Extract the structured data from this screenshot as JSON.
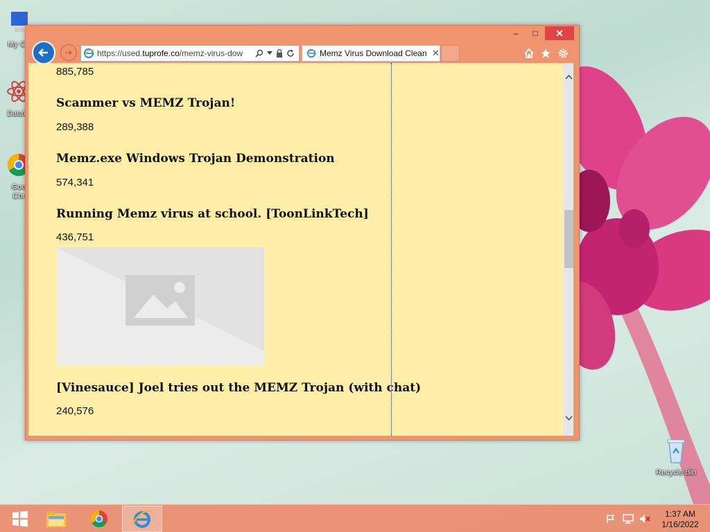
{
  "desktop": {
    "icons": [
      {
        "label": "My Co"
      },
      {
        "label": "DataW"
      },
      {
        "label": "Goo Chr"
      },
      {
        "label": "Recycle Bin"
      }
    ]
  },
  "browser": {
    "address": {
      "prefix": "https://used.",
      "domain": "tuprofe.co",
      "path": "/memz-virus-dow"
    },
    "tab": {
      "title": "Memz Virus Download Clean"
    },
    "window_buttons": {
      "minimize": "–",
      "maximize": "□",
      "close": "✕"
    }
  },
  "page": {
    "entries": [
      {
        "count": "885,785"
      },
      {
        "title": "Scammer vs MEMZ Trojan!",
        "count": "289,388"
      },
      {
        "title": "Memz.exe Windows Trojan Demonstration",
        "count": "574,341"
      },
      {
        "title": "Running Memz virus at school. [ToonLinkTech]",
        "count": "436,751"
      },
      {
        "title": "[Vinesauce] Joel tries out the MEMZ Trojan (with chat)",
        "count": "240,576"
      }
    ],
    "image_placeholder": "image-placeholder-icon"
  },
  "taskbar": {
    "items": [
      "start-icon",
      "file-explorer-icon",
      "chrome-icon",
      "internet-explorer-icon"
    ],
    "clock": {
      "time": "1:37 AM",
      "date": "1/16/2022"
    }
  },
  "colors": {
    "window_frame": "#f0946f",
    "page_bg": "#ffeea8",
    "close_red": "#e04343",
    "ie_blue": "#1c6fc9"
  }
}
